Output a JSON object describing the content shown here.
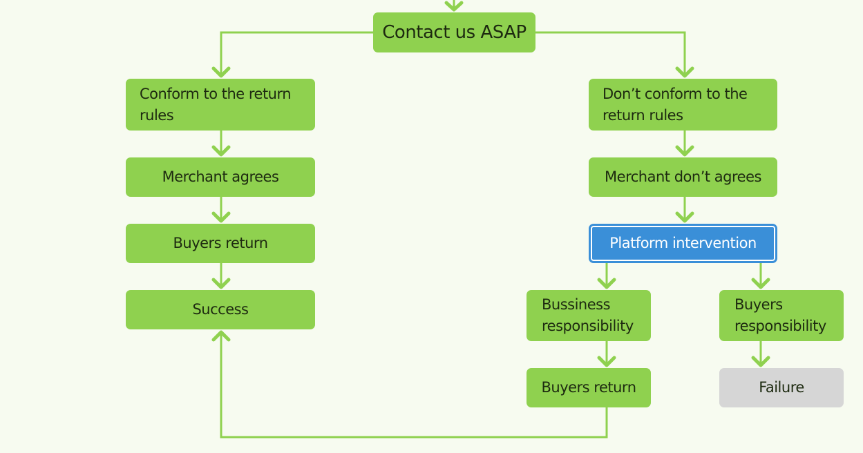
{
  "colors": {
    "node": "#8fd14f",
    "highlight": "#3a8fd8",
    "failure": "#d6d6d6",
    "connector": "#8fd14f",
    "background": "#f7fbf0"
  },
  "nodes": {
    "contact": "Contact us ASAP",
    "conform": "Conform to the return rules",
    "merchant_agrees": "Merchant agrees",
    "buyers_return_left": "Buyers return",
    "success": "Success",
    "not_conform": "Don’t conform to the return rules",
    "merchant_disagrees": "Merchant don’t agrees",
    "platform": "Platform intervention",
    "business_resp": "Bussiness responsibility",
    "buyers_resp": "Buyers responsibility",
    "buyers_return_right": "Buyers return",
    "failure": "Failure"
  }
}
